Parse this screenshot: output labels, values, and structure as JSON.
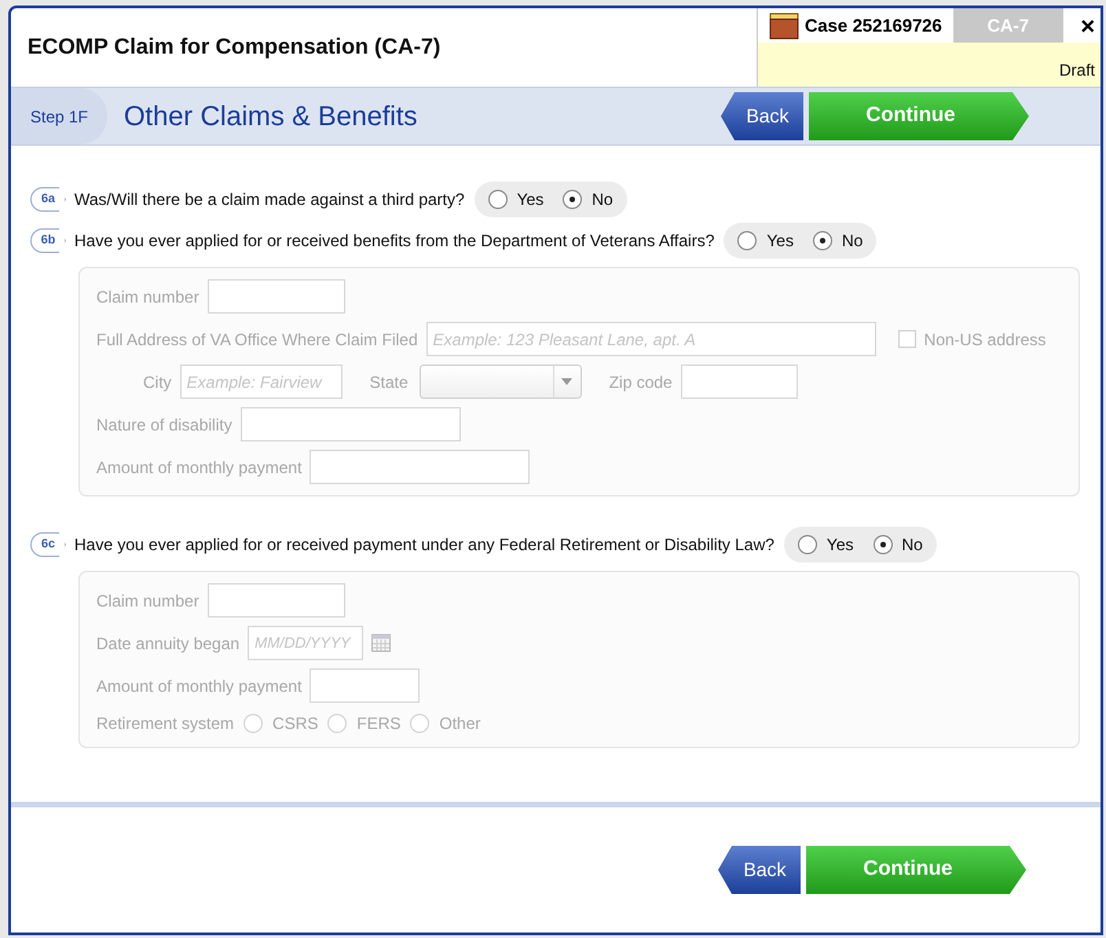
{
  "header": {
    "title": "ECOMP Claim for Compensation (CA-7)",
    "case": "Case 252169726",
    "form": "CA-7",
    "status": "Draft",
    "close": "×"
  },
  "step": {
    "label": "Step 1F",
    "title": "Other Claims & Benefits",
    "back": "Back",
    "continue": "Continue"
  },
  "questions": [
    {
      "number": "6a",
      "text": "Was/Will there be a claim made against a third party?",
      "options": [
        {
          "label": "Yes",
          "selected": false
        },
        {
          "label": "No",
          "selected": true
        }
      ]
    },
    {
      "number": "6b",
      "text": "Have you ever applied for or received benefits from the Department of Veterans Affairs?",
      "options": [
        {
          "label": "Yes",
          "selected": false
        },
        {
          "label": "No",
          "selected": true
        }
      ],
      "details": [
        {
          "kind": "short",
          "label": "Claim number"
        },
        {
          "kind": "address",
          "label": "Full Address of VA Office Where Claim Filed",
          "placeholder": "Example: 123 Pleasant Lane, apt. A",
          "checkbox": {
            "label": "Non-US address",
            "checked": false
          }
        },
        {
          "kind": "city",
          "city": {
            "label": "City",
            "placeholder": "Example: Fairview"
          },
          "state": {
            "label": "State"
          },
          "zip": {
            "label": "Zip code"
          }
        },
        {
          "kind": "medium",
          "label": "Nature of disability"
        },
        {
          "kind": "medium",
          "label": "Amount of monthly payment"
        }
      ]
    },
    {
      "number": "6c",
      "text": "Have you ever applied for or received payment under any Federal Retirement or Disability Law?",
      "options": [
        {
          "label": "Yes",
          "selected": false
        },
        {
          "label": "No",
          "selected": true
        }
      ],
      "details": [
        {
          "kind": "short",
          "label": "Claim number"
        },
        {
          "kind": "date",
          "label": "Date annuity began",
          "placeholder": "MM/DD/YYYY"
        },
        {
          "kind": "tiny",
          "label": "Amount of monthly payment"
        },
        {
          "kind": "radios",
          "label": "Retirement system",
          "options": [
            {
              "label": "CSRS",
              "selected": false
            },
            {
              "label": "FERS",
              "selected": false
            },
            {
              "label": "Other",
              "selected": false
            }
          ]
        }
      ]
    }
  ],
  "footer": {
    "back": "Back",
    "continue": "Continue"
  }
}
